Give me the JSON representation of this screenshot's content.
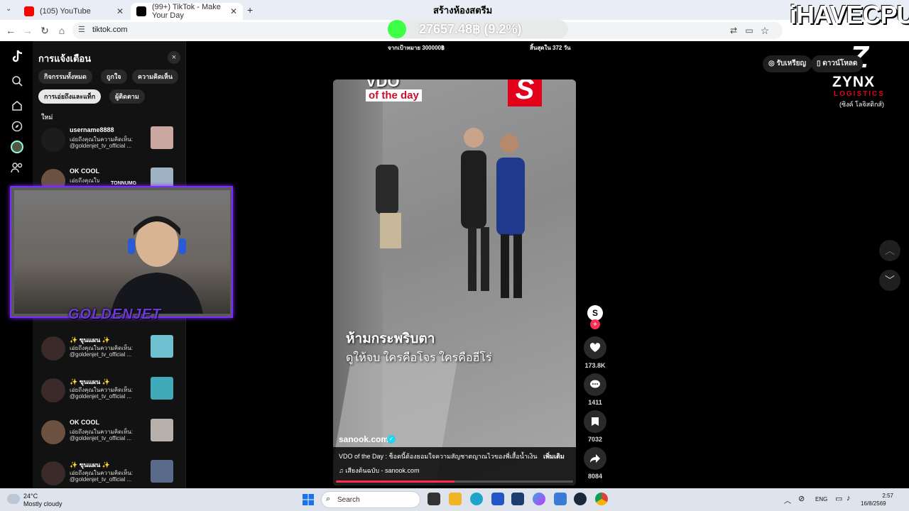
{
  "browser": {
    "tabs": [
      {
        "title": "(105) YouTube",
        "color": "#ff0000",
        "active": false
      },
      {
        "title": "(99+) TikTok - Make Your Day",
        "color": "#000000",
        "active": true
      }
    ],
    "new_tab": "+",
    "url": "tiktok.com"
  },
  "stream_overlay": {
    "donate_title": "สร้างห้องสตรีม",
    "donate_amount": "27657.48฿ (9.2%)",
    "donate_progress": 9.2,
    "goal_text": "จากเป้าหมาย 300000฿",
    "days_left": "สิ้นสุดใน 372 วัน",
    "webcam_label": "GOLDENJET",
    "webcam_handle": "TONNUMG",
    "brand_top": "iHAVECPU",
    "sponsor_name": "ZYNX",
    "sponsor_sub": "LOGISTICS",
    "sponsor_th": "(ซิงค์ โลจิสติกส์)"
  },
  "notifications": {
    "title": "การแจ้งเตือน",
    "close": "×",
    "chips": [
      "กิจกรรมทั้งหมด",
      "ถูกใจ",
      "ความคิดเห็น",
      "การเอ่ยถึงและแท็ก",
      "ผู้ติดตาม"
    ],
    "active_chip": "การเอ่ยถึงและแท็ก",
    "section": "ใหม่",
    "items": [
      {
        "name": "username8888",
        "line1": "เอ่ยถึงคุณในความคิดเห็น:",
        "line2": "@goldenjet_tv_official ...",
        "thumb": "#c9a7a0"
      },
      {
        "name": "OK COOL",
        "line1": "เอ่ยถึงคุณในความคิดเห็น:",
        "line2": "",
        "thumb": "#9fb2c4"
      },
      {
        "name": "✨ ขุนแผน ✨",
        "line1": "เอ่ยถึงคุณในความคิดเห็น:",
        "line2": "@goldenjet_tv_official ...",
        "thumb": "#6fc1d1"
      },
      {
        "name": "✨ ขุนแผน ✨",
        "line1": "เอ่ยถึงคุณในความคิดเห็น:",
        "line2": "@goldenjet_tv_official ...",
        "thumb": "#3fa9b8"
      },
      {
        "name": "OK COOL",
        "line1": "เอ่ยถึงคุณในความคิดเห็น:",
        "line2": "@goldenjet_tv_official ...",
        "thumb": "#b8b0aa"
      },
      {
        "name": "✨ ขุนแผน ✨",
        "line1": "เอ่ยถึงคุณในความคิดเห็น:",
        "line2": "@goldenjet_tv_official ...",
        "thumb": "#5a6a8a"
      }
    ]
  },
  "video": {
    "logo": "VDO",
    "logo_sub": "of the day",
    "badge": "S",
    "caption_1": "ห้ามกระพริบตา",
    "caption_2": "ดูให้จบ ใครคือโจร ใครคือฮีโร่",
    "author": "sanook.com",
    "description": "VDO of the Day : ช็อตนี้ต้องยอมใจความสัญชาตญาณไวของพี่เสื้อน้ำเงิน",
    "more": "เพิ่มเติม",
    "music": "♫  เสียงต้นฉบับ - sanook.com",
    "progress": 0.5
  },
  "actions": {
    "likes": "173.8K",
    "comments": "1411",
    "saves": "7032",
    "shares": "8084"
  },
  "right_bar": {
    "coins": "รับเหรียญ",
    "download": "ดาวน์โหลด"
  },
  "taskbar": {
    "temp": "24°C",
    "weather": "Mostly cloudy",
    "search": "Search",
    "lang": "ENG",
    "time": "2:57",
    "date": "16/8/2569"
  }
}
